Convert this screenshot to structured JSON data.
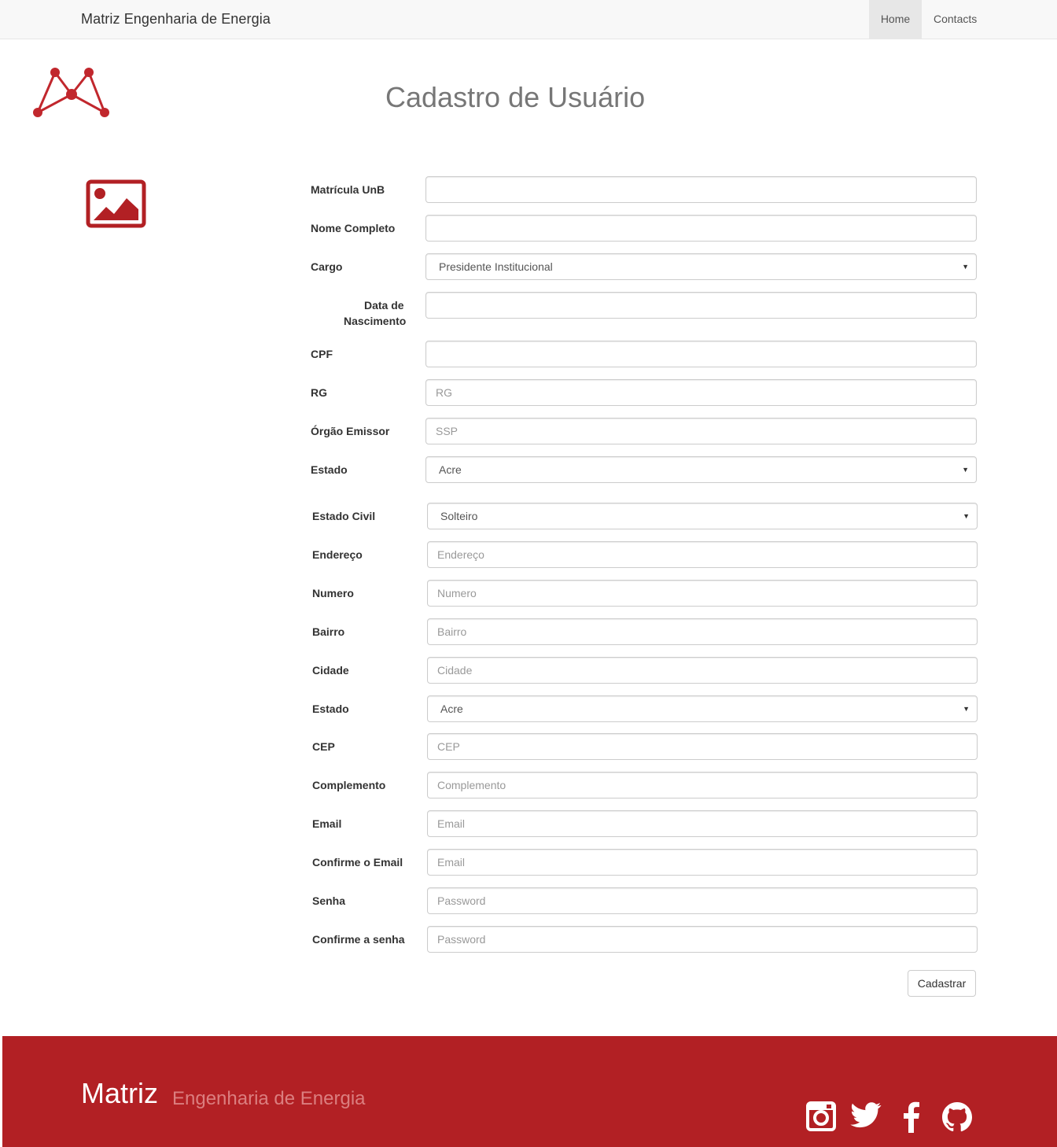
{
  "navbar": {
    "brand": "Matriz Engenharia de Energia",
    "items": [
      {
        "label": "Home",
        "active": true
      },
      {
        "label": "Contacts",
        "active": false
      }
    ]
  },
  "page": {
    "title": "Cadastro de Usuário"
  },
  "form": {
    "matricula": {
      "label": "Matrícula UnB",
      "value": "",
      "placeholder": ""
    },
    "nome": {
      "label": "Nome Completo",
      "value": "",
      "placeholder": ""
    },
    "cargo": {
      "label": "Cargo",
      "selected": "Presidente Institucional"
    },
    "nascimento": {
      "label_line1": "Data de",
      "label_line2": "Nascimento",
      "value": "",
      "placeholder": ""
    },
    "cpf": {
      "label": "CPF",
      "value": "",
      "placeholder": ""
    },
    "rg": {
      "label": "RG",
      "value": "",
      "placeholder": "RG"
    },
    "orgao": {
      "label": "Órgão Emissor",
      "value": "",
      "placeholder": "SSP"
    },
    "estado_emissor": {
      "label": "Estado",
      "selected": "Acre"
    },
    "estado_civil": {
      "label": "Estado Civil",
      "selected": "Solteiro"
    },
    "endereco": {
      "label": "Endereço",
      "value": "",
      "placeholder": "Endereço"
    },
    "numero": {
      "label": "Numero",
      "value": "",
      "placeholder": "Numero"
    },
    "bairro": {
      "label": "Bairro",
      "value": "",
      "placeholder": "Bairro"
    },
    "cidade": {
      "label": "Cidade",
      "value": "",
      "placeholder": "Cidade"
    },
    "estado": {
      "label": "Estado",
      "selected": "Acre"
    },
    "cep": {
      "label": "CEP",
      "value": "",
      "placeholder": "CEP"
    },
    "complemento": {
      "label": "Complemento",
      "value": "",
      "placeholder": "Complemento"
    },
    "email": {
      "label": "Email",
      "value": "",
      "placeholder": "Email"
    },
    "email_confirm": {
      "label": "Confirme o Email",
      "value": "",
      "placeholder": "Email"
    },
    "senha": {
      "label": "Senha",
      "value": "",
      "placeholder": "Password"
    },
    "senha_confirm": {
      "label": "Confirme a senha",
      "value": "",
      "placeholder": "Password"
    },
    "submit_label": "Cadastrar"
  },
  "footer": {
    "brand": "Matriz",
    "tagline": "Engenharia de Energia",
    "social_icons": [
      "instagram-icon",
      "twitter-icon",
      "facebook-icon",
      "github-icon"
    ]
  },
  "colors": {
    "brand_red": "#b22024",
    "navbar_bg": "#f8f8f8",
    "nav_active_bg": "#e7e7e7"
  }
}
